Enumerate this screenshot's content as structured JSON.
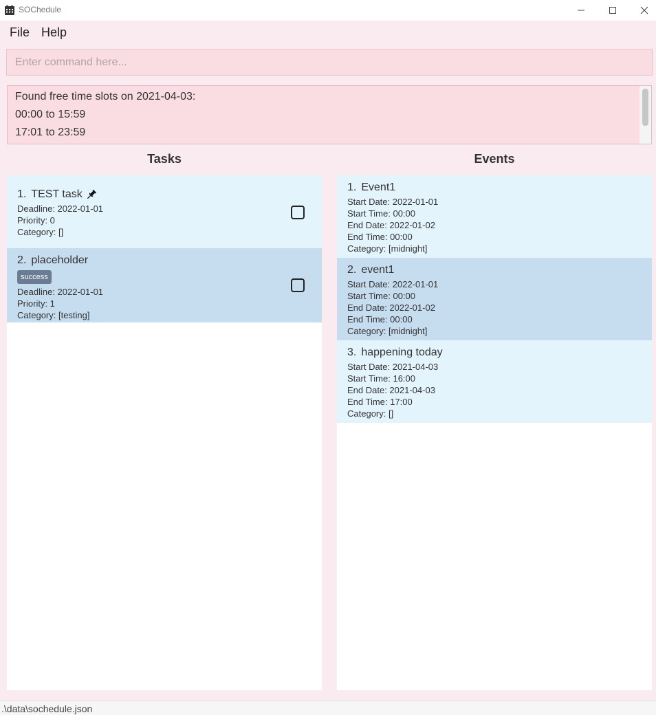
{
  "window": {
    "title": "SOChedule",
    "icon": "calendar-icon",
    "controls": [
      "minimize-icon",
      "maximize-icon",
      "close-icon"
    ]
  },
  "menu": {
    "file": "File",
    "help": "Help"
  },
  "command": {
    "placeholder": "Enter command here...",
    "value": ""
  },
  "result": {
    "lines": [
      "Found free time slots on 2021-04-03:",
      "00:00 to 15:59",
      "17:01 to 23:59"
    ]
  },
  "tasks": {
    "title": "Tasks",
    "items": [
      {
        "index": "1.",
        "name": "TEST task",
        "pinned": true,
        "tags": [],
        "deadline": "Deadline: 2022-01-01",
        "priority": "Priority: 0",
        "category": "Category: []",
        "done": false
      },
      {
        "index": "2.",
        "name": "placeholder",
        "pinned": false,
        "tags": [
          "success"
        ],
        "deadline": "Deadline: 2022-01-01",
        "priority": "Priority: 1",
        "category": "Category: [testing]",
        "done": false
      }
    ]
  },
  "events": {
    "title": "Events",
    "items": [
      {
        "index": "1.",
        "name": "Event1",
        "start_date": "Start Date: 2022-01-01",
        "start_time": "Start Time: 00:00",
        "end_date": "End Date: 2022-01-02",
        "end_time": "End Time: 00:00",
        "category": "Category: [midnight]"
      },
      {
        "index": "2.",
        "name": "event1",
        "start_date": "Start Date: 2022-01-01",
        "start_time": "Start Time: 00:00",
        "end_date": "End Date: 2022-01-02",
        "end_time": "End Time: 00:00",
        "category": "Category: [midnight]"
      },
      {
        "index": "3.",
        "name": "happening today",
        "start_date": "Start Date: 2021-04-03",
        "start_time": "Start Time: 16:00",
        "end_date": "End Date: 2021-04-03",
        "end_time": "End Time: 17:00",
        "category": "Category: []"
      }
    ]
  },
  "status": {
    "path": ".\\data\\sochedule.json"
  },
  "colors": {
    "background": "#f9ebef",
    "input": "#fadce3",
    "card_light": "#e4f4fd",
    "card_dark": "#c6dcef",
    "tag": "#6a7b94"
  }
}
